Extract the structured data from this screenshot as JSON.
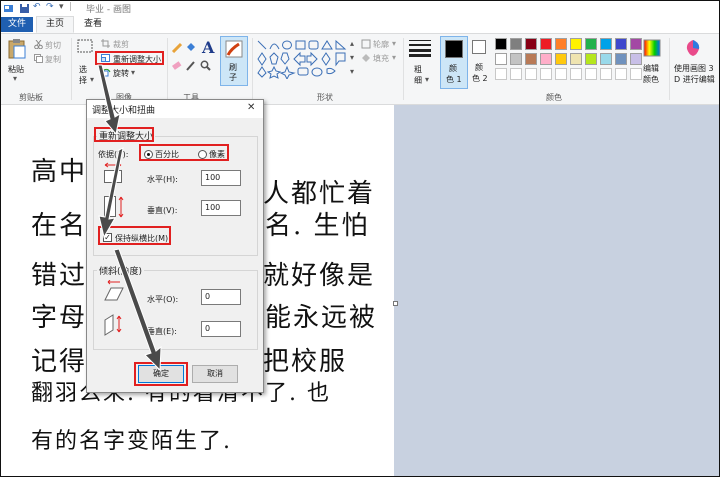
{
  "titlebar": {
    "title": "毕业 - 画图",
    "qa_undo": "↶",
    "qa_redo": "↷"
  },
  "tabs": [
    {
      "label": "文件"
    },
    {
      "label": "主页"
    },
    {
      "label": "查看"
    }
  ],
  "clipboard": {
    "paste": "粘贴",
    "cut": "剪切",
    "copy": "复制",
    "group": "剪贴板"
  },
  "image": {
    "select": "选",
    "select2": "择",
    "crop": "裁剪",
    "resize": "重新调整大小",
    "rotate": "旋转",
    "group": "图像"
  },
  "tools": {
    "group": "工具"
  },
  "brushes": {
    "label1": "刷",
    "label2": "子"
  },
  "shapes": {
    "outline": "轮廓",
    "fill": "填充",
    "group": "形状"
  },
  "size": {
    "label1": "粗",
    "label2": "细"
  },
  "color1": {
    "label1": "颜",
    "label2": "色 1"
  },
  "color2": {
    "label1": "颜",
    "label2": "色 2"
  },
  "colors": {
    "group": "颜色",
    "edit1": "编辑",
    "edit2": "颜色",
    "paint3d1": "使用画图 3",
    "paint3d2": "D 进行编辑",
    "palette_row1": [
      "#000000",
      "#7f7f7f",
      "#880015",
      "#ed1c24",
      "#ff7f27",
      "#fff200",
      "#22b14c",
      "#00a2e8",
      "#3f48cc",
      "#a349a4"
    ],
    "palette_row2": [
      "#ffffff",
      "#c3c3c3",
      "#b97a57",
      "#ffaec9",
      "#ffc90e",
      "#efe4b0",
      "#b5e61d",
      "#99d9ea",
      "#7092be",
      "#c8bfe7"
    ]
  },
  "canvas": {
    "lines": [
      "高中",
      "人都忙着",
      "在名",
      "名. 生怕",
      "错过",
      "就好像是",
      "字母",
      "能永远被",
      "记得",
      "把校服",
      "翻羽么来. 有的看清不了. 也",
      "有的名字变陌生了."
    ]
  },
  "dialog": {
    "title": "调整大小和扭曲",
    "resize_legend": "重新调整大小",
    "by_label": "依据(B):",
    "percent": "百分比",
    "pixels": "像素",
    "horizontal_label": "水平(H):",
    "horizontal_value": "100",
    "vertical_label": "垂直(V):",
    "vertical_value": "100",
    "keep_ratio": "保持纵横比(M)",
    "skew_legend": "倾斜(角度)",
    "skew_h_label": "水平(O):",
    "skew_h_value": "0",
    "skew_v_label": "垂直(E):",
    "skew_v_value": "0",
    "ok": "确定",
    "cancel": "取消"
  },
  "accent": {
    "red": "#e12020",
    "file_blue": "#1f5fb1"
  }
}
